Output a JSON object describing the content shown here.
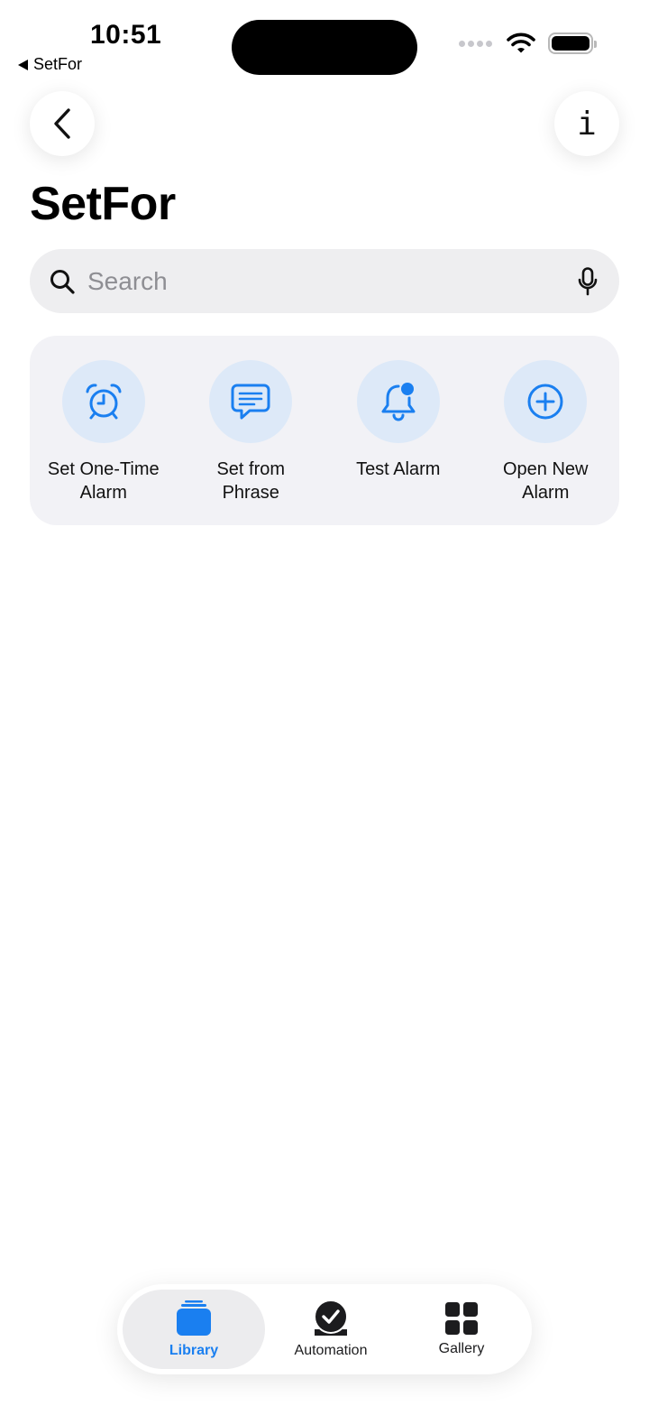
{
  "status_bar": {
    "time": "10:51",
    "back_label": "SetFor"
  },
  "nav": {
    "back_icon": "chevron-left-icon",
    "info_label": "i"
  },
  "page": {
    "title": "SetFor"
  },
  "search": {
    "placeholder": "Search"
  },
  "actions": [
    {
      "label": "Set One-Time Alarm",
      "icon": "alarm-clock-icon"
    },
    {
      "label": "Set from Phrase",
      "icon": "message-bubble-icon"
    },
    {
      "label": "Test Alarm",
      "icon": "bell-badge-icon"
    },
    {
      "label": "Open New Alarm",
      "icon": "plus-circle-icon"
    }
  ],
  "tabbar": {
    "tabs": [
      {
        "label": "Library",
        "icon": "library-stack-icon",
        "selected": true
      },
      {
        "label": "Automation",
        "icon": "automation-check-icon",
        "selected": false
      },
      {
        "label": "Gallery",
        "icon": "gallery-grid-icon",
        "selected": false
      }
    ]
  },
  "colors": {
    "accent": "#1a7ff0",
    "action_circle": "#dde9f8",
    "card_bg": "#f2f2f6",
    "search_bg": "#eeeef0"
  }
}
